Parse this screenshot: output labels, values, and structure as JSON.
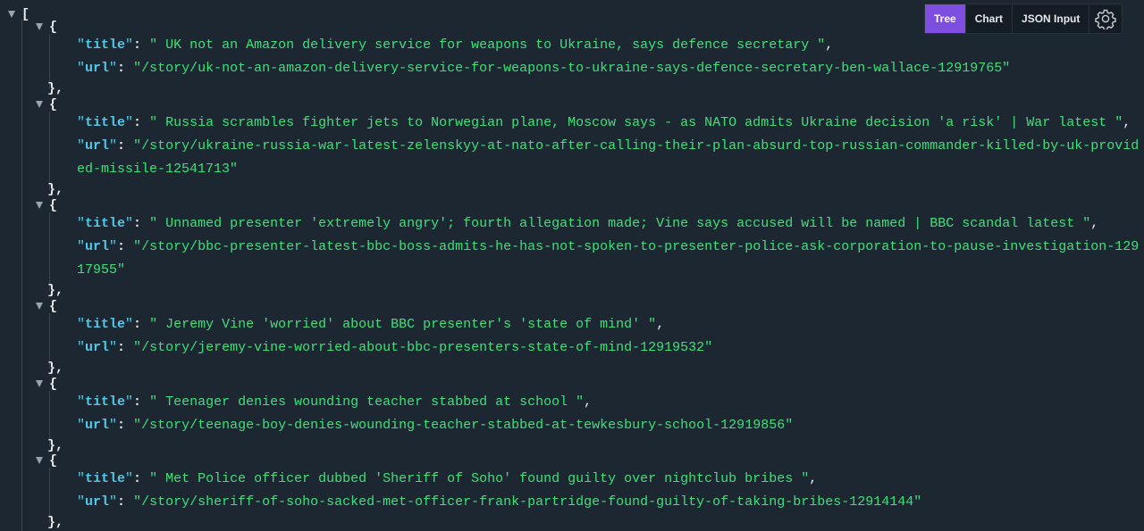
{
  "toolbar": {
    "tabs": [
      {
        "label": "Tree",
        "active": true
      },
      {
        "label": "Chart",
        "active": false
      },
      {
        "label": "JSON Input",
        "active": false
      }
    ],
    "settings_icon": "gear-icon",
    "accent_color": "#7d4ee0"
  },
  "tree": {
    "root_open": "[",
    "item_open": "{",
    "item_close": "},",
    "key_title": "title",
    "key_url": "url",
    "items": [
      {
        "title": " UK not an Amazon delivery service for weapons to Ukraine, says defence secretary ",
        "url": "/story/uk-not-an-amazon-delivery-service-for-weapons-to-ukraine-says-defence-secretary-ben-wallace-12919765"
      },
      {
        "title": " Russia scrambles fighter jets to Norwegian plane, Moscow says - as NATO admits Ukraine decision 'a risk' | War latest ",
        "url": "/story/ukraine-russia-war-latest-zelenskyy-at-nato-after-calling-their-plan-absurd-top-russian-commander-killed-by-uk-provided-missile-12541713"
      },
      {
        "title": " Unnamed presenter 'extremely angry'; fourth allegation made; Vine says accused will be named | BBC scandal latest ",
        "url": "/story/bbc-presenter-latest-bbc-boss-admits-he-has-not-spoken-to-presenter-police-ask-corporation-to-pause-investigation-12917955"
      },
      {
        "title": " Jeremy Vine 'worried' about BBC presenter's 'state of mind' ",
        "url": "/story/jeremy-vine-worried-about-bbc-presenters-state-of-mind-12919532"
      },
      {
        "title": " Teenager denies wounding teacher stabbed at school ",
        "url": "/story/teenage-boy-denies-wounding-teacher-stabbed-at-tewkesbury-school-12919856"
      },
      {
        "title": " Met Police officer dubbed 'Sheriff of Soho' found guilty over nightclub bribes ",
        "url": "/story/sheriff-of-soho-sacked-met-officer-frank-partridge-found-guilty-of-taking-bribes-12914144"
      }
    ]
  }
}
